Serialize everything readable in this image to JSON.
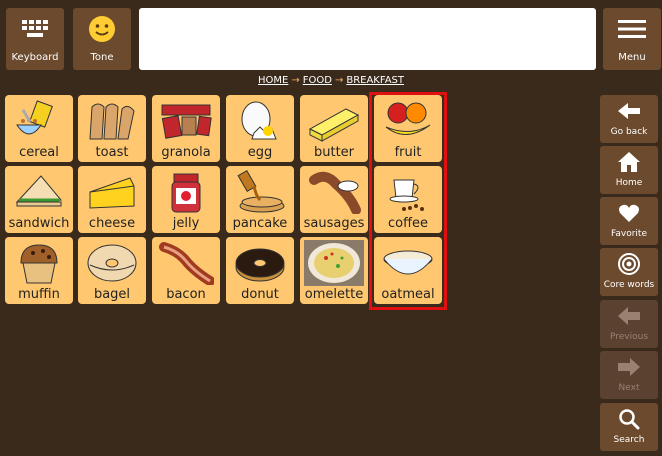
{
  "toolbar": {
    "keyboard_label": "Keyboard",
    "tone_label": "Tone",
    "menu_label": "Menu",
    "message_text": ""
  },
  "breadcrumb": {
    "home": "HOME",
    "food": "FOOD",
    "breakfast": "BREAKFAST",
    "separator": "→"
  },
  "tiles": [
    {
      "word": "cereal",
      "icon": "cereal-bowl-icon"
    },
    {
      "word": "toast",
      "icon": "toast-icon"
    },
    {
      "word": "granola",
      "icon": "granola-bar-icon"
    },
    {
      "word": "egg",
      "icon": "egg-icon"
    },
    {
      "word": "butter",
      "icon": "butter-icon"
    },
    {
      "word": "fruit",
      "icon": "fruit-icon"
    },
    {
      "word": "sandwich",
      "icon": "sandwich-icon"
    },
    {
      "word": "cheese",
      "icon": "cheese-icon"
    },
    {
      "word": "jelly",
      "icon": "jelly-jar-icon"
    },
    {
      "word": "pancake",
      "icon": "pancake-icon"
    },
    {
      "word": "sausages",
      "icon": "sausages-icon"
    },
    {
      "word": "coffee",
      "icon": "coffee-cup-icon"
    },
    {
      "word": "muffin",
      "icon": "muffin-icon"
    },
    {
      "word": "bagel",
      "icon": "bagel-icon"
    },
    {
      "word": "bacon",
      "icon": "bacon-icon"
    },
    {
      "word": "donut",
      "icon": "donut-icon"
    },
    {
      "word": "omelette",
      "icon": "omelette-photo"
    },
    {
      "word": "oatmeal",
      "icon": "oatmeal-bowl-icon"
    }
  ],
  "sidebar": {
    "items": [
      {
        "label": "Go back",
        "icon": "back-icon",
        "enabled": true
      },
      {
        "label": "Home",
        "icon": "home-icon",
        "enabled": true
      },
      {
        "label": "Favorite",
        "icon": "heart-icon",
        "enabled": true
      },
      {
        "label": "Core words",
        "icon": "target-icon",
        "enabled": true
      },
      {
        "label": "Previous",
        "icon": "arrow-left-icon",
        "enabled": false
      },
      {
        "label": "Next",
        "icon": "arrow-right-icon",
        "enabled": false
      },
      {
        "label": "Search",
        "icon": "search-icon",
        "enabled": true
      }
    ]
  },
  "colors": {
    "background": "#3a2a1c",
    "button": "#6b4a2e",
    "tile": "#ffc870",
    "highlight": "#e01010"
  }
}
